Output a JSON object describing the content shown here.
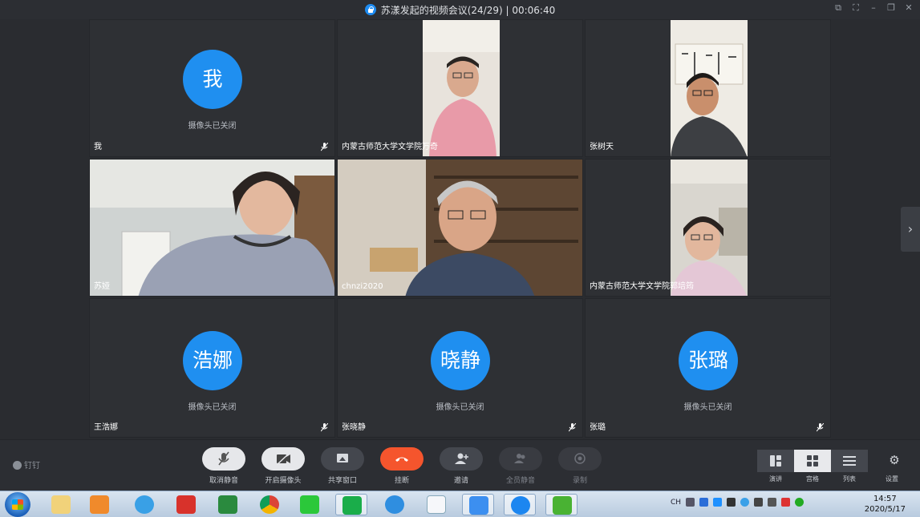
{
  "window": {
    "title": "苏漾发起的视频会议(24/29) | 00:06:40"
  },
  "tiles": [
    {
      "avatar": "我",
      "camera_status": "摄像头已关闭",
      "name": "我"
    },
    {
      "name": "内蒙古师范大学文学院万奇"
    },
    {
      "name": "张树天"
    },
    {
      "name": "苏娅"
    },
    {
      "name": "chnzi2020"
    },
    {
      "name": "内蒙古师范大学文学院郭培筠"
    },
    {
      "avatar": "浩娜",
      "camera_status": "摄像头已关闭",
      "name": "王浩娜"
    },
    {
      "avatar": "晓静",
      "camera_status": "摄像头已关闭",
      "name": "张晓静"
    },
    {
      "avatar": "张璐",
      "camera_status": "摄像头已关闭",
      "name": "张璐"
    }
  ],
  "toolbar": {
    "brand": "钉钉",
    "unmute": "取消静音",
    "camera_on": "开启摄像头",
    "share_window": "共享窗口",
    "hang_up": "挂断",
    "invite": "邀请",
    "mute_all": "全员静音",
    "record": "录制",
    "speaker_view": "演讲",
    "grid_view": "宫格",
    "list_view": "列表",
    "settings": "设置"
  },
  "taskbar": {
    "ime": "CH",
    "time": "14:57",
    "date": "2020/5/17"
  },
  "colors": {
    "accent": "#1f8ff0",
    "hangup": "#f5552d"
  }
}
